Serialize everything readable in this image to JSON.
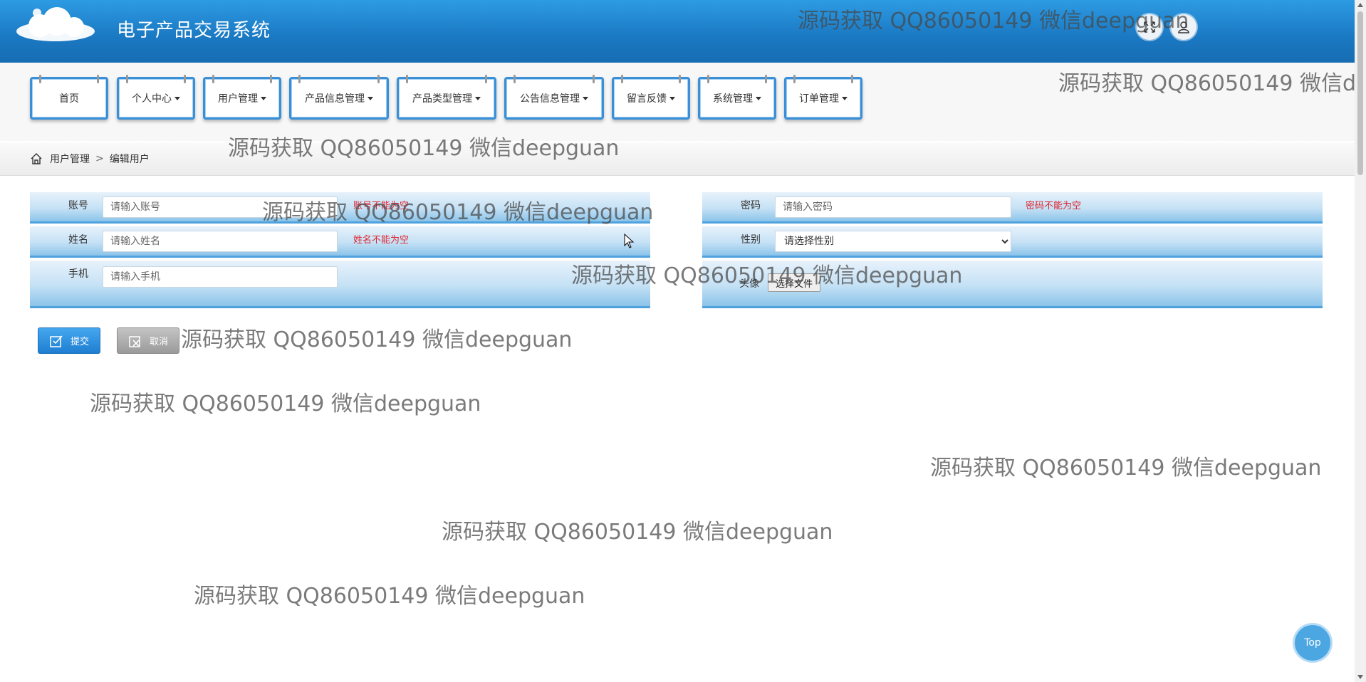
{
  "header": {
    "title": "电子产品交易系统",
    "fullscreen_icon": "expand-icon",
    "user_icon": "user-icon"
  },
  "nav": {
    "items": [
      {
        "label": "首页",
        "dropdown": false
      },
      {
        "label": "个人中心",
        "dropdown": true
      },
      {
        "label": "用户管理",
        "dropdown": true
      },
      {
        "label": "产品信息管理",
        "dropdown": true
      },
      {
        "label": "产品类型管理",
        "dropdown": true
      },
      {
        "label": "公告信息管理",
        "dropdown": true
      },
      {
        "label": "留言反馈",
        "dropdown": true
      },
      {
        "label": "系统管理",
        "dropdown": true
      },
      {
        "label": "订单管理",
        "dropdown": true
      }
    ]
  },
  "breadcrumb": {
    "icon": "home-icon",
    "parent": "用户管理",
    "separator": ">",
    "current": "编辑用户"
  },
  "form": {
    "account": {
      "label": "账号",
      "placeholder": "请输入账号",
      "error": "账号不能为空"
    },
    "password": {
      "label": "密码",
      "placeholder": "请输入密码",
      "error": "密码不能为空"
    },
    "name": {
      "label": "姓名",
      "placeholder": "请输入姓名",
      "error": "姓名不能为空"
    },
    "gender": {
      "label": "性别",
      "selected": "请选择性别"
    },
    "phone": {
      "label": "手机",
      "placeholder": "请输入手机"
    },
    "avatar": {
      "label": "头像",
      "button": "选择文件"
    }
  },
  "actions": {
    "submit": "提交",
    "cancel": "取消"
  },
  "watermark": "源码获取 QQ86050149 微信deepguan",
  "top_button": "Top",
  "colors": {
    "header": "#1a78c2",
    "nav_border": "#3b8fd6",
    "error": "#e0242f",
    "submit": "#2b8fd9",
    "cancel": "#a8a8a8"
  }
}
